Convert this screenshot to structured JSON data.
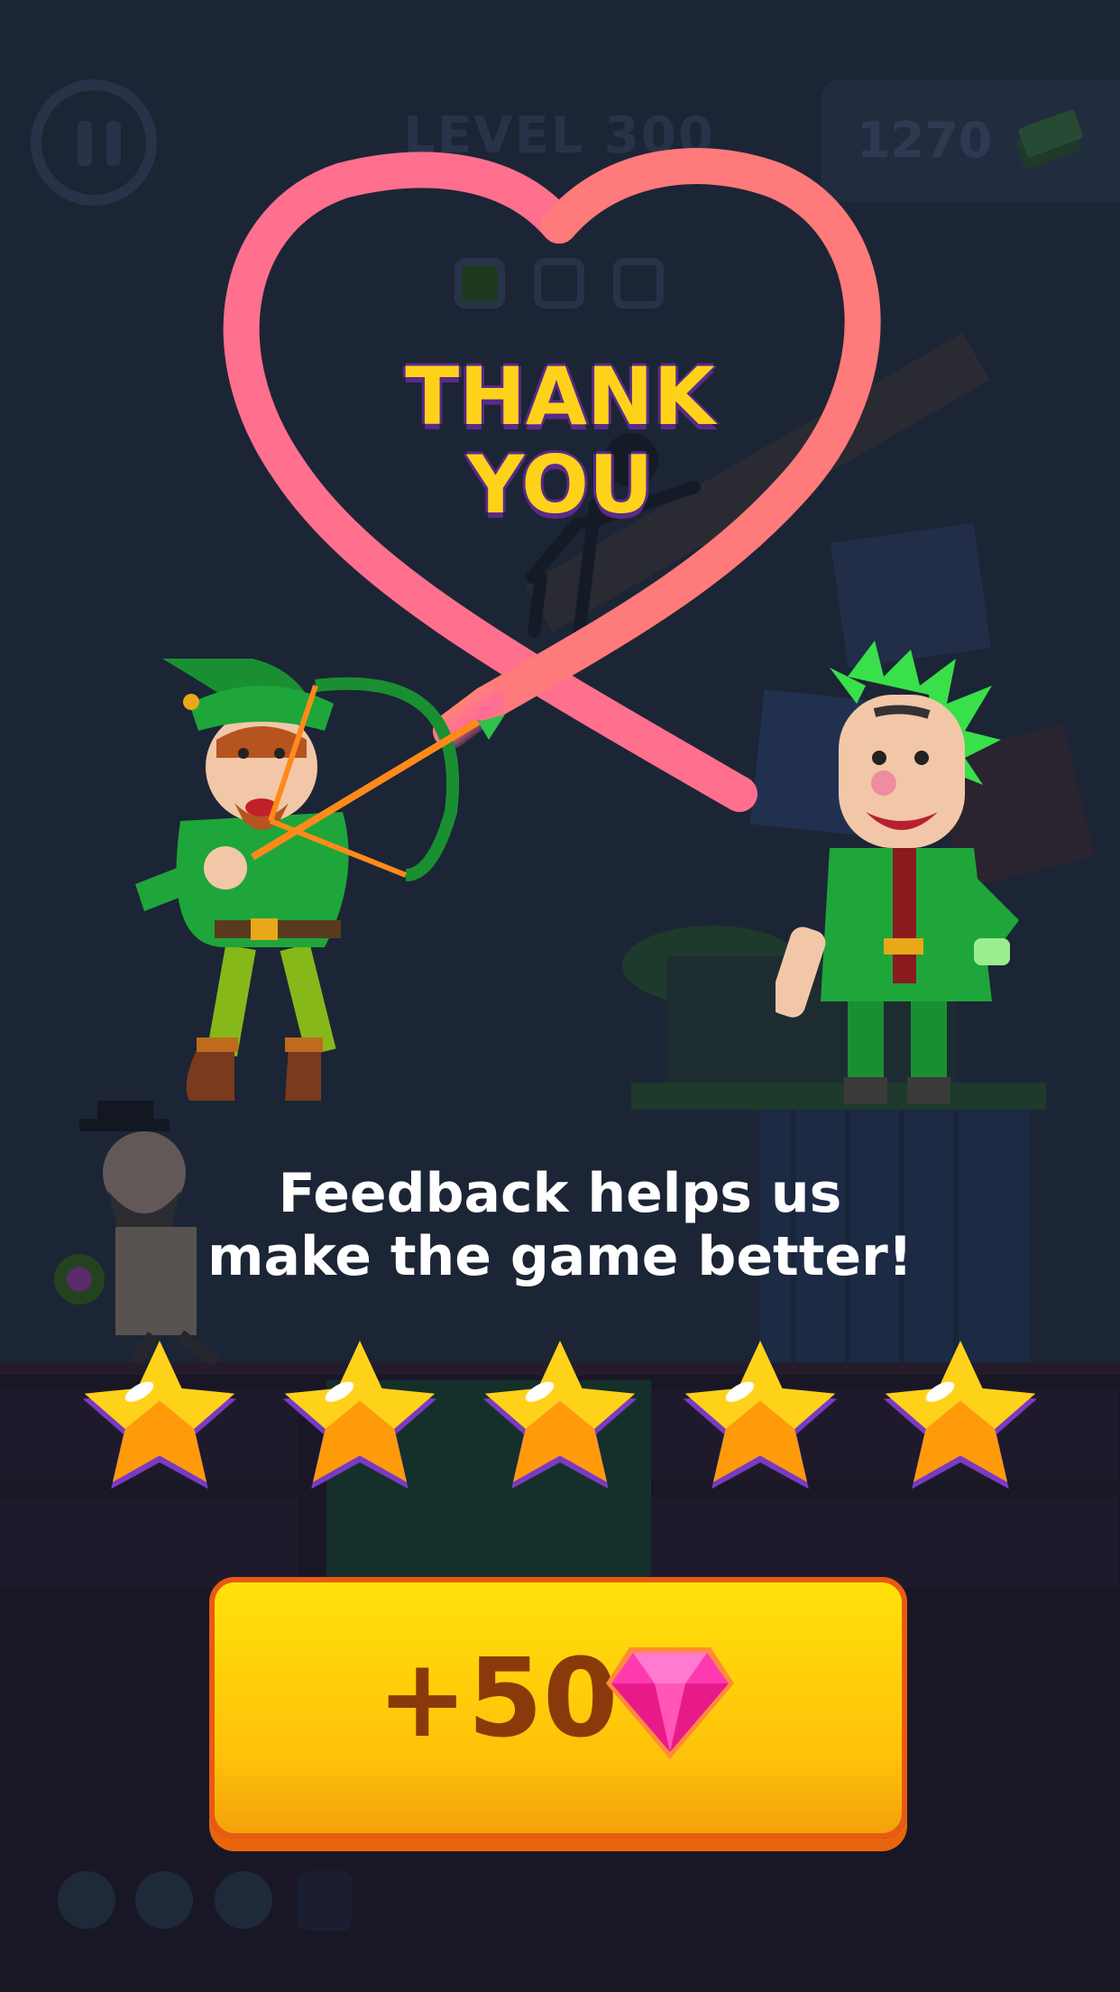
{
  "hud": {
    "level_label": "LEVEL 300",
    "money_value": "1270"
  },
  "popup": {
    "title_line1": "THANK",
    "title_line2": "YOU",
    "subtitle_line1": "Feedback helps us",
    "subtitle_line2": "make the game better!",
    "stars": [
      {
        "name": "star-1"
      },
      {
        "name": "star-2"
      },
      {
        "name": "star-3"
      },
      {
        "name": "star-4"
      },
      {
        "name": "star-5"
      }
    ],
    "reward_button": {
      "label": "+50",
      "icon": "pink-gem-icon"
    }
  },
  "colors": {
    "background": "#1c2535",
    "title_fill": "#ffd21a",
    "heart_stroke": "#ff6f8e",
    "button_fill": "#ffc10a",
    "button_text": "#8a3a0a"
  }
}
